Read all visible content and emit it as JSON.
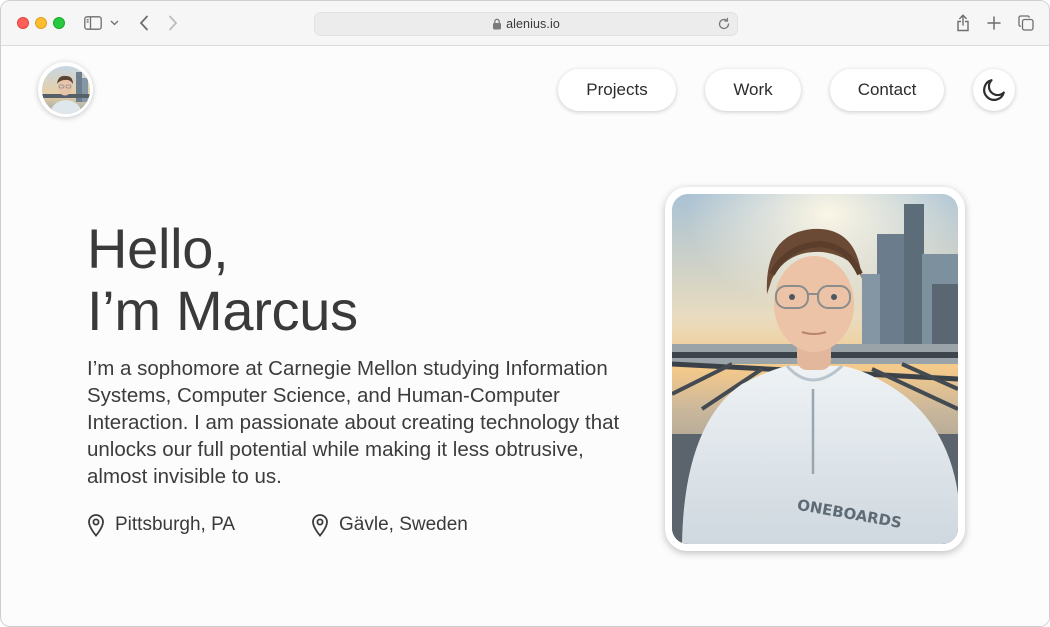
{
  "browser": {
    "url": "alenius.io"
  },
  "nav": {
    "projects": "Projects",
    "work": "Work",
    "contact": "Contact"
  },
  "hero": {
    "greeting_line1": "Hello,",
    "greeting_line2": "I’m Marcus",
    "bio": "I’m a sophomore at Carnegie Mellon studying Information Systems, Computer Science, and Human-Computer Interaction. I am passionate about creating technology that unlocks our full potential while making it less obtrusive, almost invisible to us."
  },
  "locations": [
    {
      "label": "Pittsburgh, PA",
      "icon": "map-pin-icon"
    },
    {
      "label": "Gävle, Sweden",
      "icon": "map-pin-icon"
    }
  ],
  "icons": {
    "theme_toggle": "moon-icon",
    "avatar": "profile-photo",
    "portrait": "portrait-photo"
  },
  "colors": {
    "text": "#3a3a3a",
    "background": "#fcfcfc",
    "traffic_red": "#fe5f57",
    "traffic_yellow": "#febc2e",
    "traffic_green": "#28c840"
  }
}
